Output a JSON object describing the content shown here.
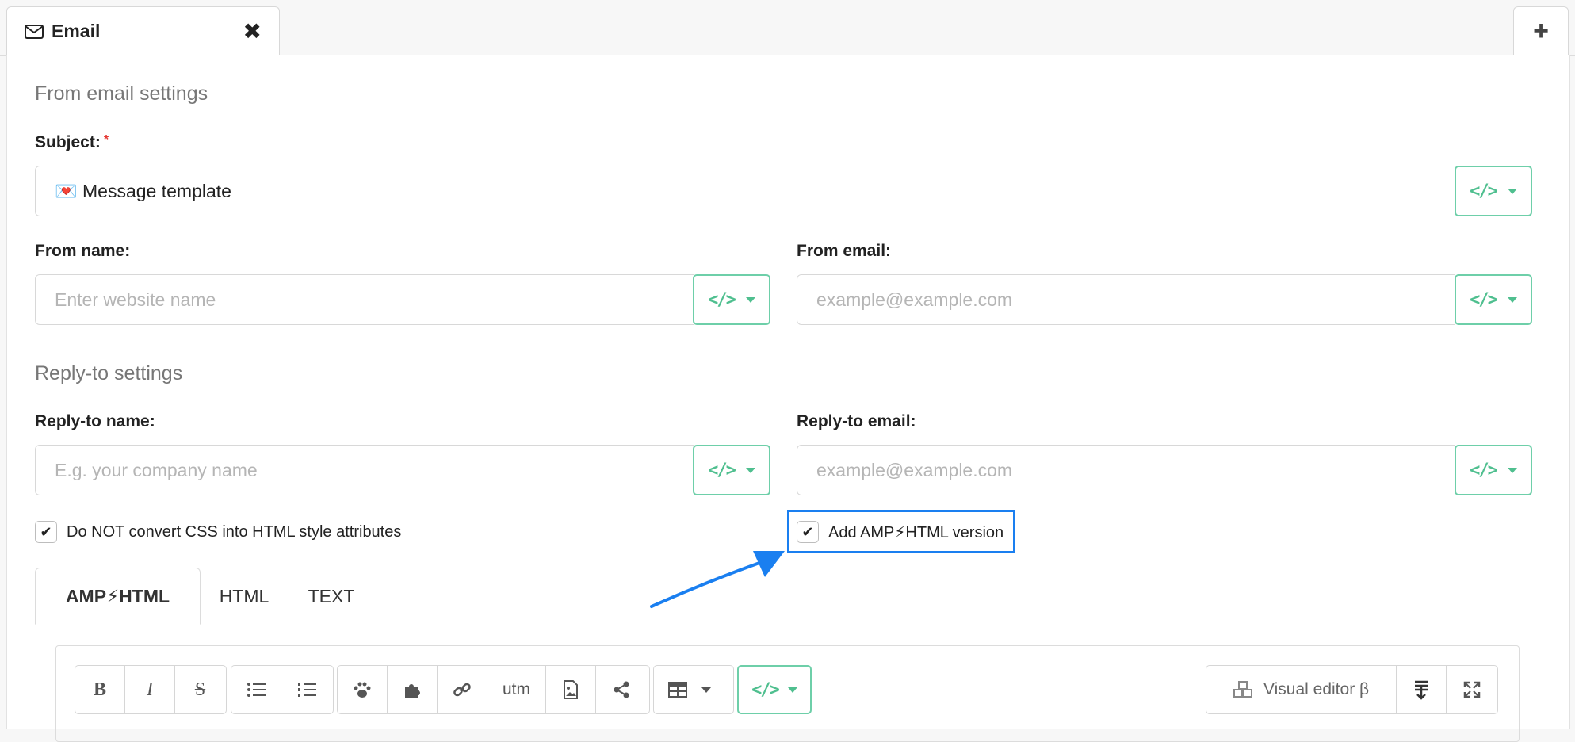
{
  "tab": {
    "label": "Email",
    "add_symbol": "+",
    "close_symbol": "✖"
  },
  "sections": {
    "from": "From email settings",
    "reply": "Reply-to settings"
  },
  "subject": {
    "label": "Subject:",
    "required_mark": "*",
    "value": "💌 Message template"
  },
  "from_name": {
    "label": "From name:",
    "placeholder": "Enter website name"
  },
  "from_email": {
    "label": "From email:",
    "placeholder": "example@example.com"
  },
  "reply_name": {
    "label": "Reply-to name:",
    "placeholder": "E.g. your company name"
  },
  "reply_email": {
    "label": "Reply-to email:",
    "placeholder": "example@example.com"
  },
  "template_button": {
    "symbol": "</>"
  },
  "checkboxes": {
    "css": {
      "label": "Do NOT convert CSS into HTML style attributes",
      "checked": true
    },
    "amp": {
      "label": "Add AMP⚡HTML version",
      "checked": true
    },
    "check_symbol": "✔"
  },
  "editor_tabs": [
    "AMP⚡HTML",
    "HTML",
    "TEXT"
  ],
  "toolbar": {
    "bold": "B",
    "italic": "I",
    "strike": "S",
    "utm": "utm",
    "code": "</>",
    "visual_editor": "Visual editor β"
  },
  "colors": {
    "accent_green": "#4fbf8f",
    "highlight_blue": "#1a7ff0",
    "required_red": "#e53935"
  }
}
